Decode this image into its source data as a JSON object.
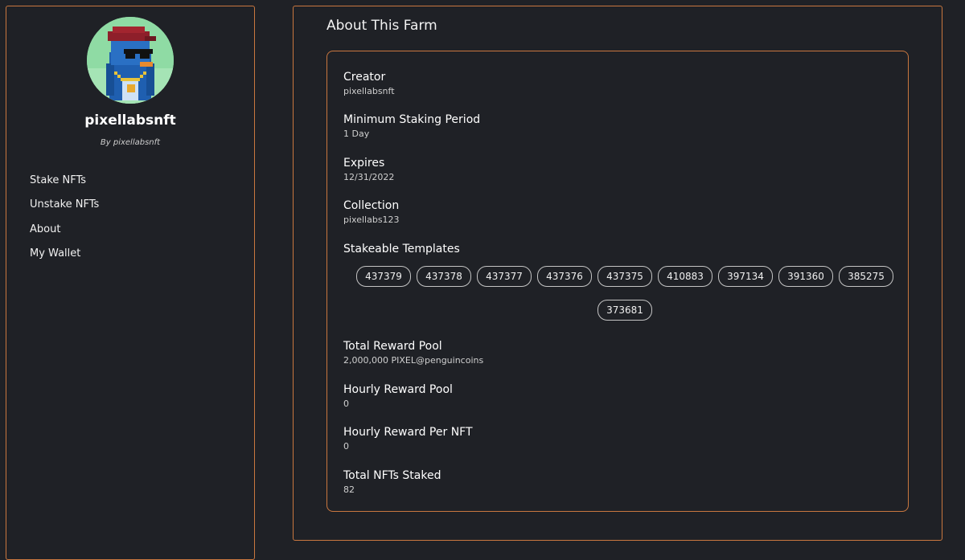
{
  "sidebar": {
    "profile_name": "pixellabsnft",
    "profile_by": "By pixellabsnft",
    "nav": [
      {
        "label": "Stake NFTs"
      },
      {
        "label": "Unstake NFTs"
      },
      {
        "label": "About"
      },
      {
        "label": "My Wallet"
      }
    ]
  },
  "main": {
    "title": "About This Farm",
    "creator": {
      "label": "Creator",
      "value": "pixellabsnft"
    },
    "min_staking": {
      "label": "Minimum Staking Period",
      "value": "1 Day"
    },
    "expires": {
      "label": "Expires",
      "value": "12/31/2022"
    },
    "collection": {
      "label": "Collection",
      "value": "pixellabs123"
    },
    "templates": {
      "label": "Stakeable Templates",
      "items": [
        "437379",
        "437378",
        "437377",
        "437376",
        "437375",
        "410883",
        "397134",
        "391360",
        "385275",
        "373681"
      ]
    },
    "total_reward_pool": {
      "label": "Total Reward Pool",
      "value": "2,000,000 PIXEL@penguincoins"
    },
    "hourly_reward_pool": {
      "label": "Hourly Reward Pool",
      "value": "0"
    },
    "hourly_reward_per_nft": {
      "label": "Hourly Reward Per NFT",
      "value": "0"
    },
    "total_nfts_staked": {
      "label": "Total NFTs Staked",
      "value": "82"
    }
  },
  "colors": {
    "background": "#1f2126",
    "border_accent": "#c9773f",
    "chip_border": "#c4c4c4"
  },
  "icons": {
    "avatar": "pixel-penguin-avatar"
  }
}
